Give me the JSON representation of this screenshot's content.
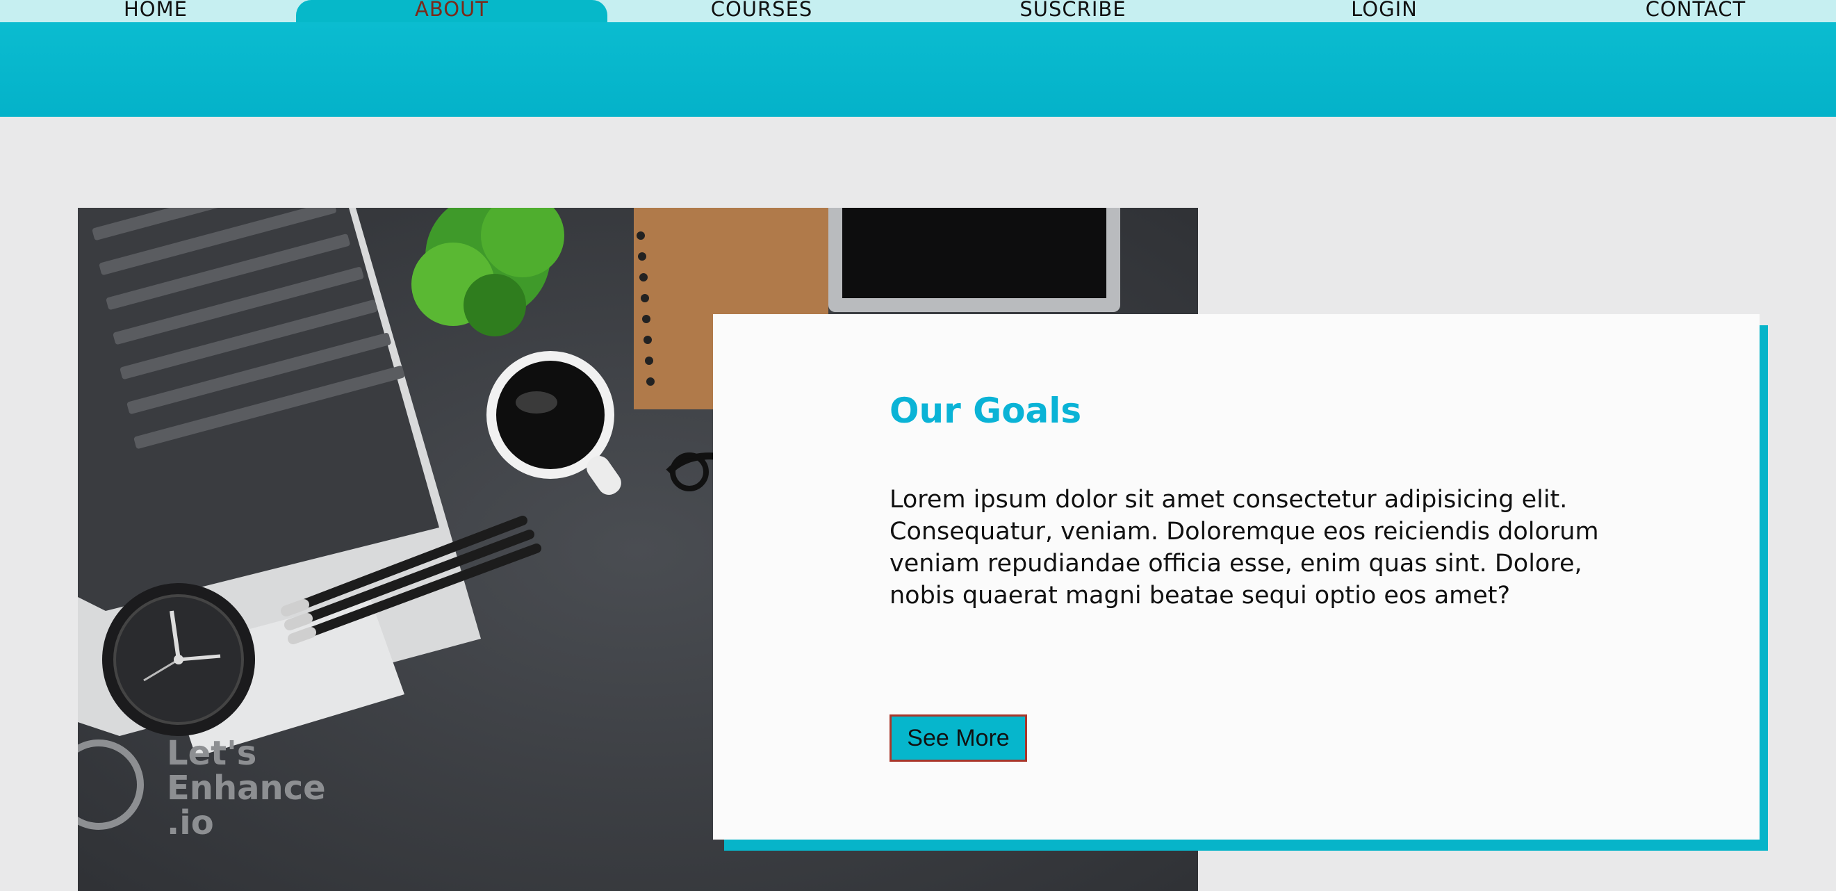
{
  "nav": {
    "items": [
      {
        "label": "HOME"
      },
      {
        "label": "ABOUT"
      },
      {
        "label": "COURSES"
      },
      {
        "label": "SUSCRIBE"
      },
      {
        "label": "LOGIN"
      },
      {
        "label": "CONTACT"
      }
    ],
    "active": "ABOUT"
  },
  "card": {
    "title": "Our Goals",
    "body": "Lorem ipsum dolor sit amet consectetur adipisicing elit. Consequatur, veniam. Doloremque eos reiciendis dolorum veniam repudiandae officia esse, enim quas sint. Dolore, nobis quaerat magni beatae sequi optio eos amet?",
    "button_label": "See More"
  },
  "hero": {
    "watermark_line1": "Let's",
    "watermark_line2": "Enhance",
    "watermark_line3": ".io"
  },
  "colors": {
    "accent": "#06b8c9",
    "nav_bg": "#c6eff1",
    "page_bg": "#e9e9ea",
    "title": "#0ab3d6"
  }
}
